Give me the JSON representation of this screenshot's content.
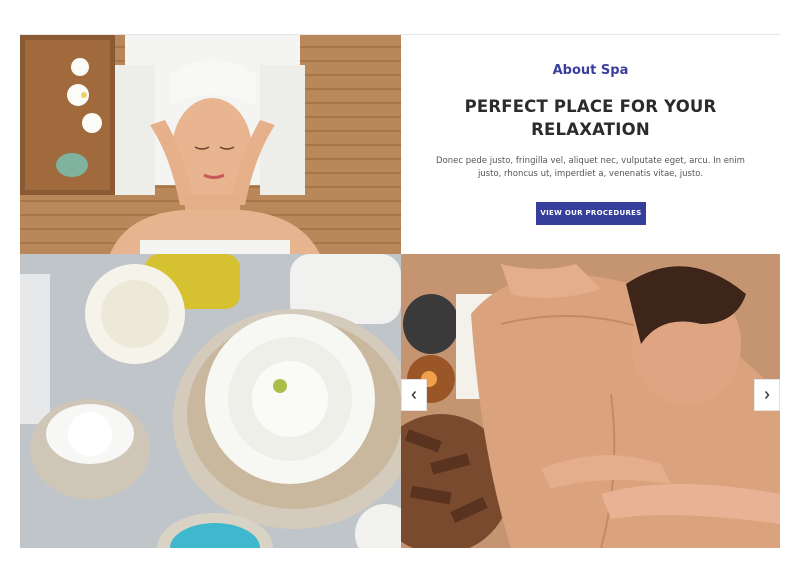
{
  "about": {
    "eyebrow": "About Spa",
    "heading_line1": "PERFECT PLACE FOR YOUR",
    "heading_line2": "RELAXATION",
    "body": "Donec pede justo, fringilla vel, aliquet nec, vulputate eget, arcu. In enim justo, rhoncus ut, imperdiet a, venenatis vitae, justo.",
    "button_label": "VIEW OUR PROCEDURES"
  },
  "slider": {
    "prev_icon": "chevron-left-icon",
    "next_icon": "chevron-right-icon"
  },
  "images": [
    {
      "name": "spa-facial-photo",
      "subject": "facial-massage"
    },
    {
      "name": "spa-flower-bowl-photo",
      "subject": "flower-bowl-candle"
    },
    {
      "name": "spa-back-massage-photo",
      "subject": "back-massage"
    }
  ],
  "colors": {
    "accent": "#353e9a",
    "eyebrow": "#3a3f9d",
    "heading": "#2b2b2b",
    "body_text": "#555555"
  }
}
